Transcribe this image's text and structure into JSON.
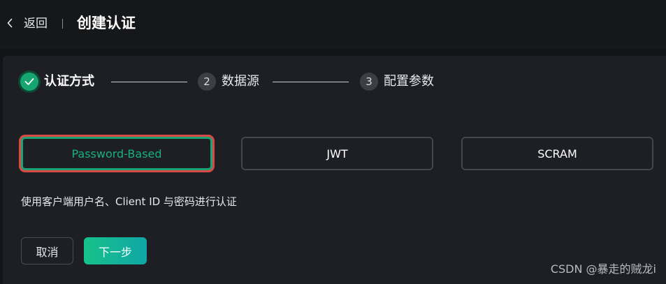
{
  "header": {
    "back_label": "返回",
    "title": "创建认证",
    "back_icon": "chevron-left-icon"
  },
  "steps": [
    {
      "number": "",
      "label": "认证方式",
      "state": "done",
      "icon": "check-icon"
    },
    {
      "number": "2",
      "label": "数据源",
      "state": "pending"
    },
    {
      "number": "3",
      "label": "配置参数",
      "state": "pending"
    }
  ],
  "methods": [
    {
      "label": "Password-Based",
      "selected": true
    },
    {
      "label": "JWT",
      "selected": false
    },
    {
      "label": "SCRAM",
      "selected": false
    }
  ],
  "description": "使用客户端用户名、Client ID 与密码进行认证",
  "buttons": {
    "cancel": "取消",
    "next": "下一步"
  },
  "watermark": "CSDN @暴走的贼龙i",
  "colors": {
    "accent": "#17a673",
    "selection_outline": "#d94a44",
    "panel": "#1d1f24",
    "background": "#131417"
  }
}
